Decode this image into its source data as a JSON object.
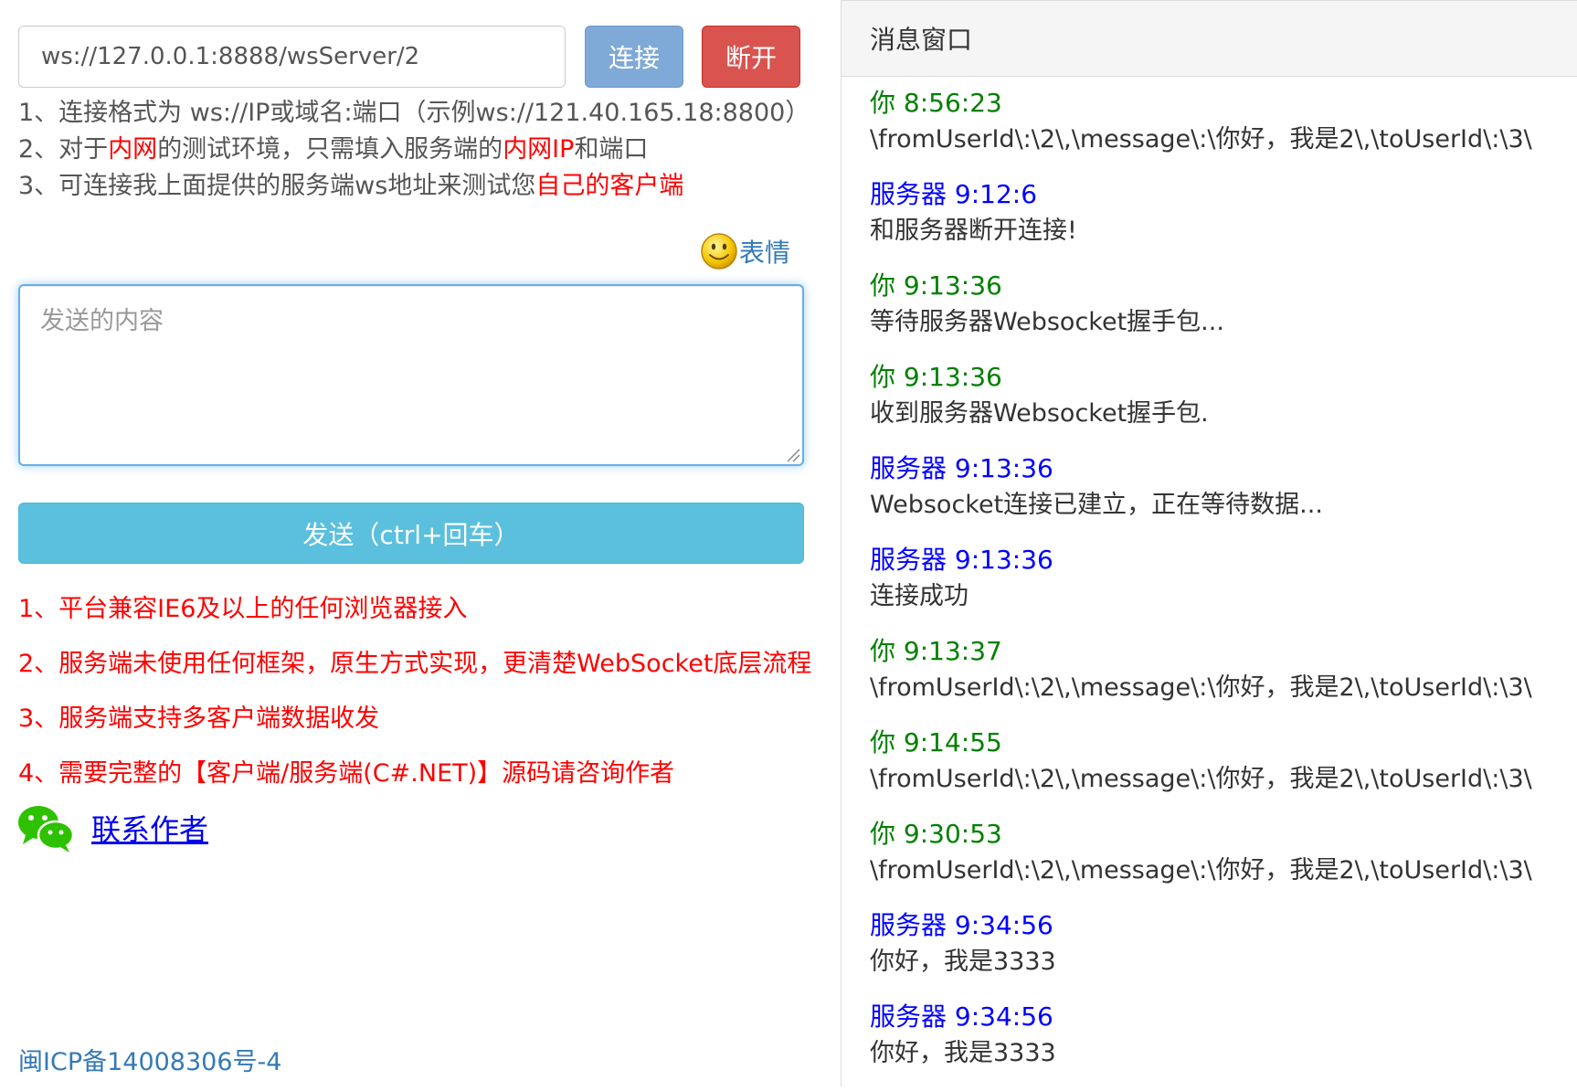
{
  "connection": {
    "url_value": "ws://127.0.0.1:8888/wsServer/2",
    "connect_label": "连接",
    "disconnect_label": "断开"
  },
  "tips": {
    "line1": "1、连接格式为 ws://IP或域名:端口（示例ws://121.40.165.18:8800）",
    "line2_a": "2、对于",
    "line2_b": "内网",
    "line2_c": "的测试环境，只需填入服务端的",
    "line2_d": "内网IP",
    "line2_e": "和端口",
    "line3_a": "3、可连接我上面提供的服务端ws地址来测试您",
    "line3_b": "自己的客户端"
  },
  "composer": {
    "emoji_label": "表情",
    "icon": "smiley-face-icon",
    "placeholder": "发送的内容",
    "send_label": "发送（ctrl+回车）"
  },
  "features": [
    "1、平台兼容IE6及以上的任何浏览器接入",
    "2、服务端未使用任何框架，原生方式实现，更清楚WebSocket底层流程",
    "3、服务端支持多客户端数据收发",
    "4、需要完整的【客户端/服务端(C#.NET)】源码请咨询作者"
  ],
  "contact": {
    "icon": "wechat-icon",
    "label": "联系作者"
  },
  "footer": {
    "icp": "闽ICP备14008306号-4"
  },
  "message_panel": {
    "title": "消息窗口",
    "messages": [
      {
        "sender": "你",
        "time": "8:56:23",
        "text": "\\fromUserId\\:\\2\\,\\message\\:\\你好，我是2\\,\\toUserId\\:\\3\\"
      },
      {
        "sender": "服务器",
        "time": "9:12:6",
        "text": "和服务器断开连接!"
      },
      {
        "sender": "你",
        "time": "9:13:36",
        "text": "等待服务器Websocket握手包..."
      },
      {
        "sender": "你",
        "time": "9:13:36",
        "text": "收到服务器Websocket握手包."
      },
      {
        "sender": "服务器",
        "time": "9:13:36",
        "text": "Websocket连接已建立，正在等待数据..."
      },
      {
        "sender": "服务器",
        "time": "9:13:36",
        "text": "连接成功"
      },
      {
        "sender": "你",
        "time": "9:13:37",
        "text": "\\fromUserId\\:\\2\\,\\message\\:\\你好，我是2\\,\\toUserId\\:\\3\\"
      },
      {
        "sender": "你",
        "time": "9:14:55",
        "text": "\\fromUserId\\:\\2\\,\\message\\:\\你好，我是2\\,\\toUserId\\:\\3\\"
      },
      {
        "sender": "你",
        "time": "9:30:53",
        "text": "\\fromUserId\\:\\2\\,\\message\\:\\你好，我是2\\,\\toUserId\\:\\3\\"
      },
      {
        "sender": "服务器",
        "time": "9:34:56",
        "text": "你好，我是3333"
      },
      {
        "sender": "服务器",
        "time": "9:34:56",
        "text": "你好，我是3333"
      }
    ]
  },
  "colors": {
    "you": "#008000",
    "server": "#0000ff",
    "highlight": "#ff0000",
    "connect": "#7fa9d6",
    "disconnect": "#d9534f",
    "send": "#5bc0de",
    "link": "#337ab7"
  }
}
